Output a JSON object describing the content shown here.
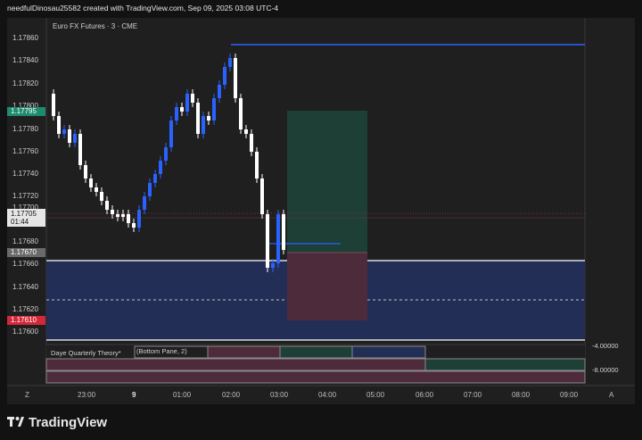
{
  "header": {
    "caption": "needfulDinosau25582 created with TradingView.com, Sep 09, 2025 03:08 UTC-4"
  },
  "symbol": {
    "title": "Euro FX Futures · 3 · CME"
  },
  "price_axis": {
    "ticks": [
      "1.17860",
      "1.17840",
      "1.17820",
      "1.17800",
      "1.17780",
      "1.17760",
      "1.17740",
      "1.17720",
      "1.17700",
      "1.17680",
      "1.17660",
      "1.17640",
      "1.17620",
      "1.17600"
    ],
    "badges": [
      {
        "text": "1.17795",
        "color": "#1e8b6e"
      },
      {
        "text": "1.17705",
        "sub": "01:44",
        "color": "#e6e6e6"
      },
      {
        "text": "1.17670",
        "color": "#6a6a6a"
      },
      {
        "text": "1.17610",
        "color": "#d3283a"
      }
    ]
  },
  "time_axis": {
    "labels": [
      "23:00",
      "9",
      "01:00",
      "02:00",
      "03:00",
      "04:00",
      "05:00",
      "06:00",
      "07:00",
      "08:00",
      "09:00"
    ],
    "left_btn": "Z",
    "right_btn": "A"
  },
  "indicator": {
    "title": "Daye Quarterly Theory*",
    "args": "(Bottom Pane, 2)",
    "axis": [
      "-4.00000",
      "-8.00000"
    ]
  },
  "brand": {
    "name": "TradingView"
  },
  "colors": {
    "bull": "#2962ff",
    "bear": "#ffffff",
    "zone_blue": "#232e57",
    "zone_green": "#1d3f36",
    "zone_red": "#4e2b3b"
  }
}
